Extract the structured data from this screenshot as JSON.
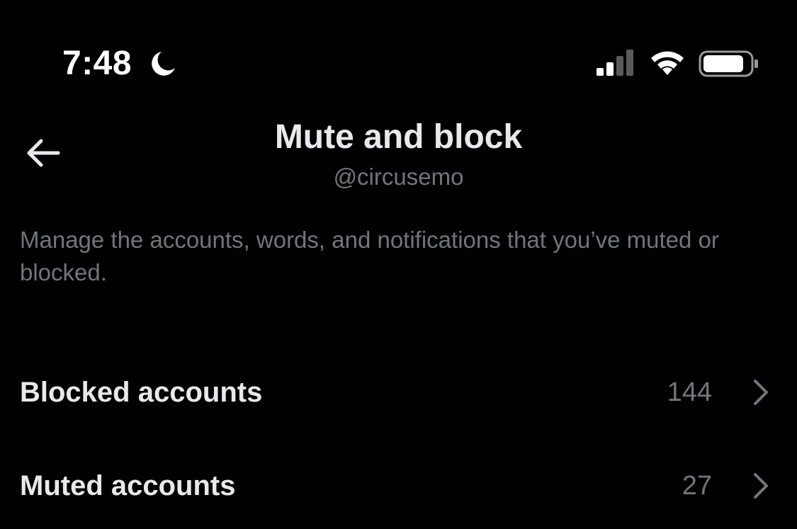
{
  "status_bar": {
    "time": "7:48",
    "focus_icon": "moon-icon",
    "signal_icon": "cellular-signal-icon",
    "wifi_icon": "wifi-icon",
    "battery_icon": "battery-icon"
  },
  "header": {
    "back_icon": "back-arrow-icon",
    "title": "Mute and block",
    "subtitle": "@circusemo"
  },
  "description": "Manage the accounts, words, and notifications that you’ve muted or blocked.",
  "rows": [
    {
      "label": "Blocked accounts",
      "count": "144",
      "icon": "chevron-right-icon"
    },
    {
      "label": "Muted accounts",
      "count": "27",
      "icon": "chevron-right-icon"
    }
  ],
  "colors": {
    "background": "#000000",
    "primary_text": "#e7e9ea",
    "secondary_text": "#71767b"
  }
}
